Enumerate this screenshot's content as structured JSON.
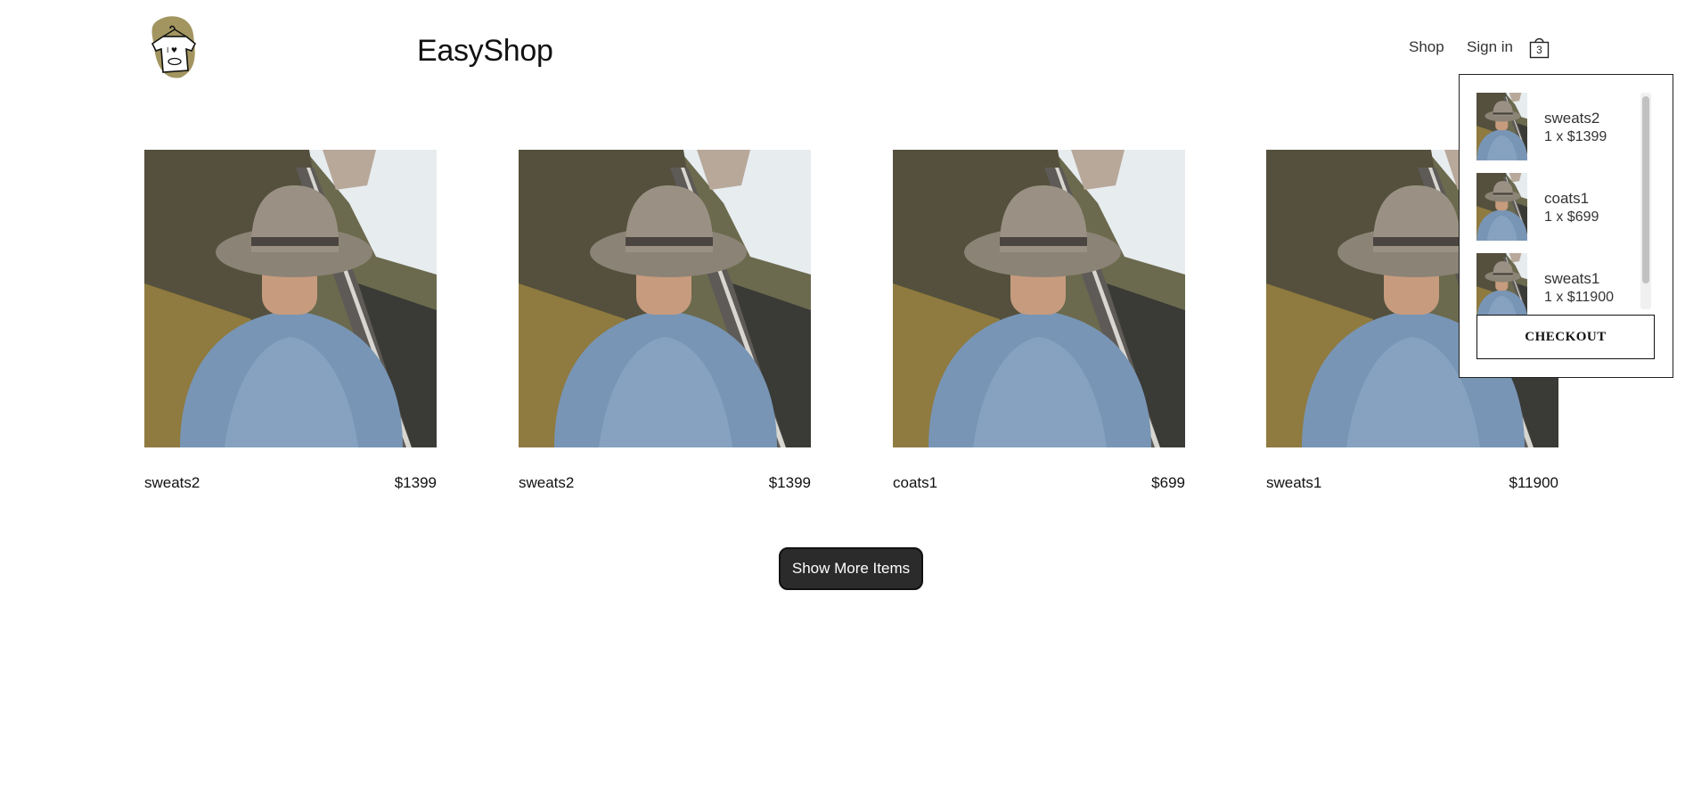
{
  "header": {
    "brand": "EasyShop",
    "nav": {
      "shop": "Shop",
      "sign_in": "Sign in"
    },
    "cart_count": "3",
    "logo_icon": "tshirt-hanger-logo",
    "bag_icon": "shopping-bag-icon"
  },
  "products": [
    {
      "name": "sweats2",
      "price": "$1399"
    },
    {
      "name": "sweats2",
      "price": "$1399"
    },
    {
      "name": "coats1",
      "price": "$699"
    },
    {
      "name": "sweats1",
      "price": "$11900"
    }
  ],
  "show_more_label": "Show More Items",
  "cart": {
    "items": [
      {
        "name": "sweats2",
        "qty_price": "1 x $1399"
      },
      {
        "name": "coats1",
        "qty_price": "1 x $699"
      },
      {
        "name": "sweats1",
        "qty_price": "1 x $11900"
      }
    ],
    "checkout_label": "CHECKOUT"
  },
  "colors": {
    "button_bg": "#2b2b2b",
    "logo_blob": "#a39560"
  }
}
